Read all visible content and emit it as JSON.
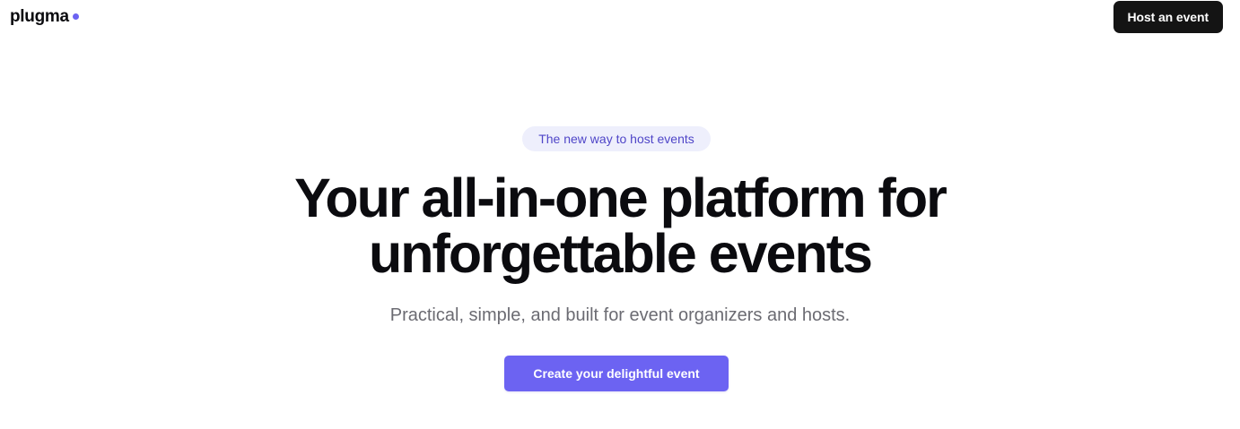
{
  "header": {
    "logo_text": "plugma",
    "host_button_label": "Host an event"
  },
  "hero": {
    "badge": "The new way to host events",
    "headline_line1": "Your all-in-one platform for",
    "headline_line2": "unforgettable events",
    "subheadline": "Practical, simple, and built for event organizers and hosts.",
    "cta_label": "Create your delightful event"
  },
  "colors": {
    "accent": "#6c63f2",
    "badge_background": "#eeeffc",
    "badge_text": "#4f46c8",
    "dark_button": "#141414",
    "heading": "#0b0b0f",
    "muted_text": "#6b6b72"
  }
}
